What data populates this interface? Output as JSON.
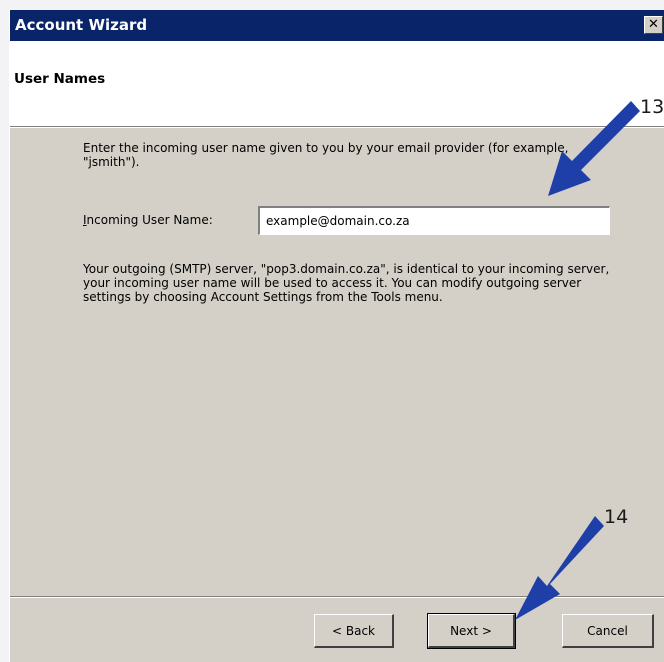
{
  "window": {
    "title": "Account Wizard",
    "close_glyph": "✕"
  },
  "header": {
    "title": "User Names"
  },
  "content": {
    "intro_text": "Enter the incoming user name given to you by your email provider (for example, \"jsmith\").",
    "field": {
      "label_accel": "I",
      "label_rest": "ncoming User Name:",
      "value": "example@domain.co.za"
    },
    "info_text": "Your outgoing (SMTP) server, \"pop3.domain.co.za\", is identical to your incoming server, your incoming user name will be used to access it. You can modify outgoing server settings by choosing Account Settings from the Tools menu."
  },
  "buttons": {
    "back": "< Back",
    "next": "Next >",
    "cancel": "Cancel"
  },
  "annotations": {
    "callout_1": "13",
    "callout_2": "14",
    "arrow_color": "#1f3fa8"
  },
  "colors": {
    "titlebar": "#0a246a",
    "dialog_face": "#d4d0c8",
    "header_bg": "#ffffff"
  }
}
